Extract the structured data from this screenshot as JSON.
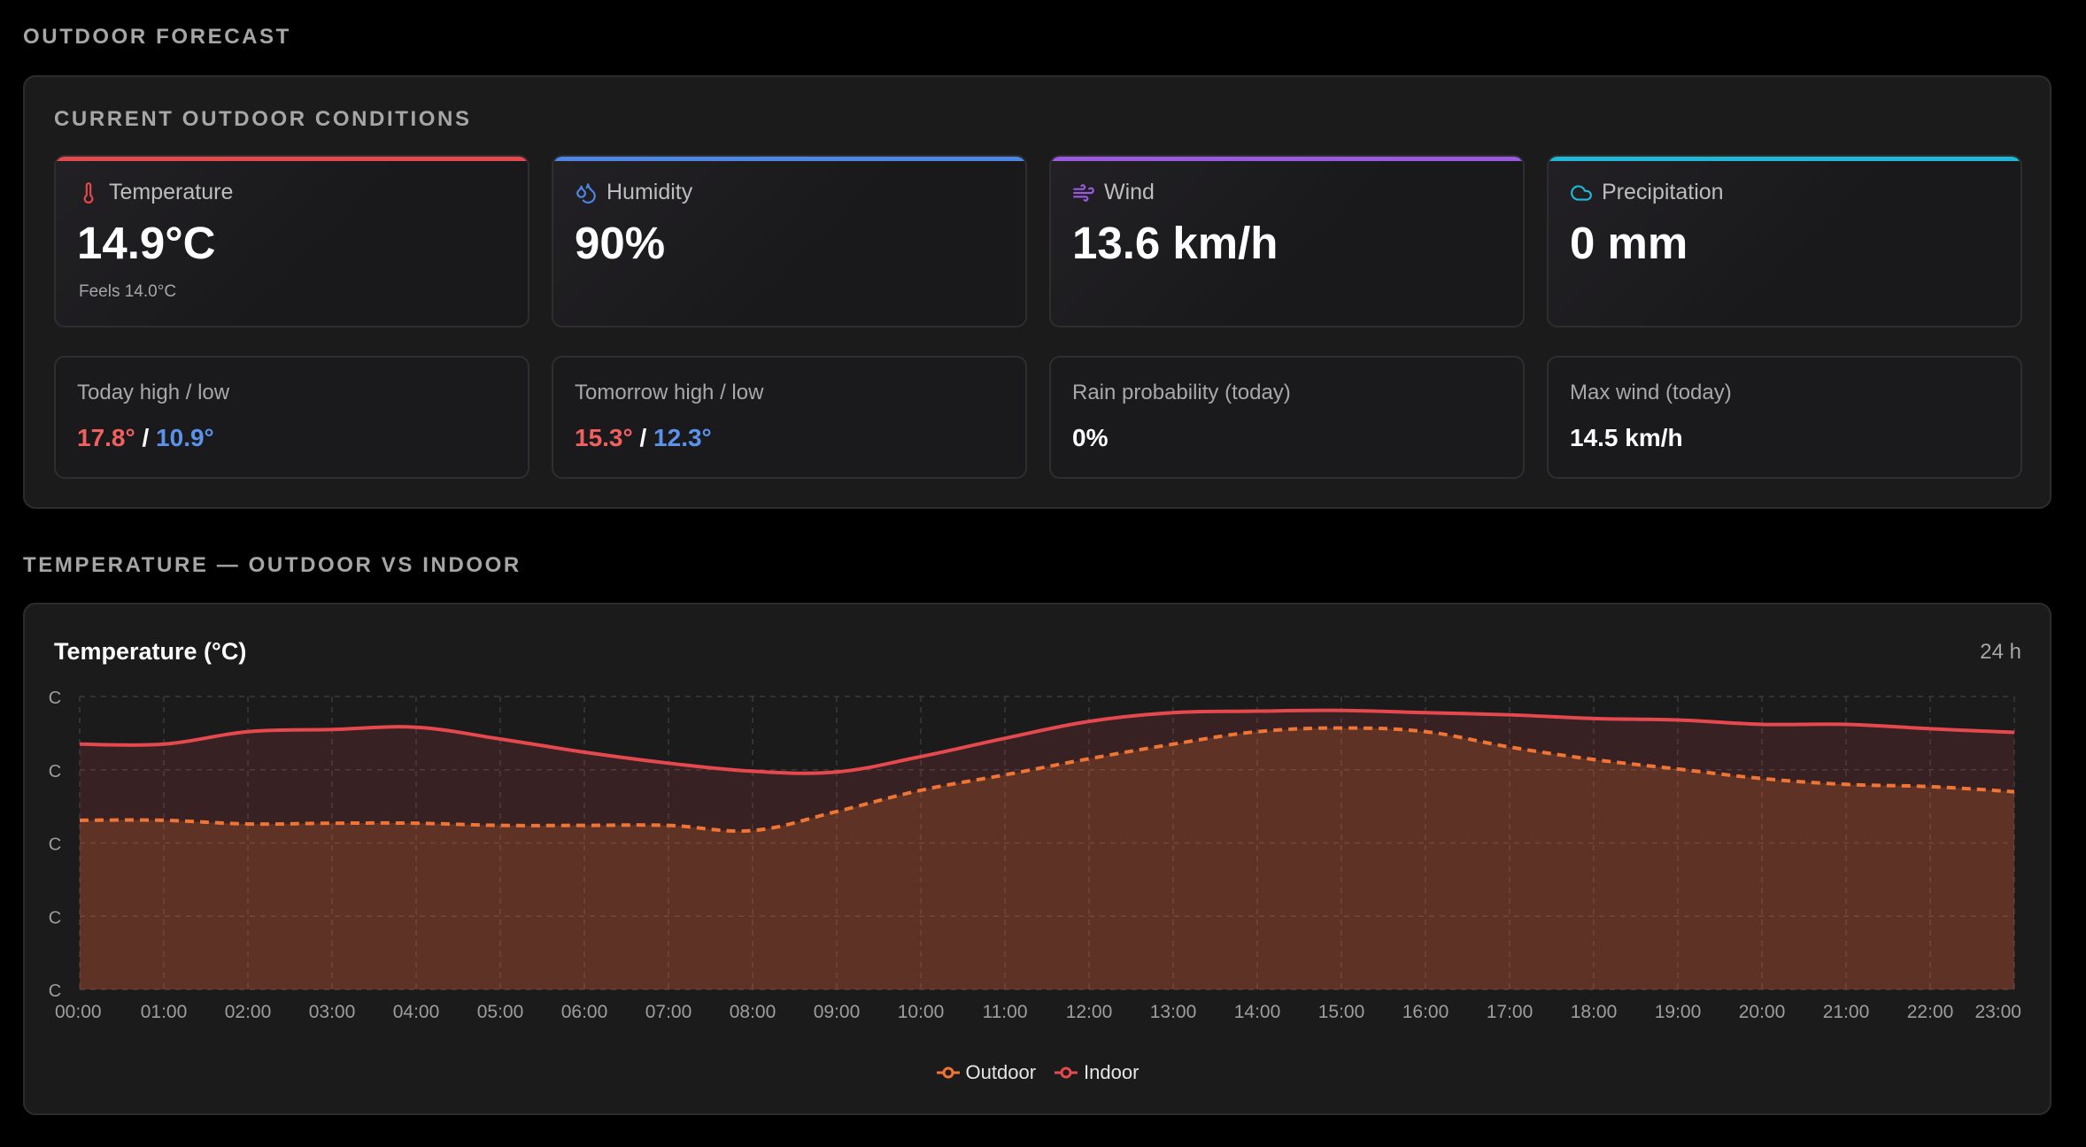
{
  "sections": {
    "forecast_title": "OUTDOOR FORECAST",
    "chart_section_title": "TEMPERATURE — OUTDOOR VS INDOOR"
  },
  "conditions": {
    "title": "CURRENT OUTDOOR CONDITIONS",
    "cards": [
      {
        "label": "Temperature",
        "value": "14.9°C",
        "sub": "Feels 14.0°C",
        "icon": "thermometer-icon",
        "accent": "#e5484d"
      },
      {
        "label": "Humidity",
        "value": "90%",
        "icon": "droplets-icon",
        "accent": "#4e86e6"
      },
      {
        "label": "Wind",
        "value": "13.6 km/h",
        "icon": "wind-icon",
        "accent": "#9b59e0"
      },
      {
        "label": "Precipitation",
        "value": "0 mm",
        "icon": "cloud-icon",
        "accent": "#1fb8d6"
      }
    ],
    "stats": [
      {
        "label": "Today high / low",
        "high": "17.8°",
        "low": "10.9°",
        "sep": " / "
      },
      {
        "label": "Tomorrow high / low",
        "high": "15.3°",
        "low": "12.3°",
        "sep": " / "
      },
      {
        "label": "Rain probability (today)",
        "value": "0%"
      },
      {
        "label": "Max wind (today)",
        "value": "14.5 km/h"
      }
    ]
  },
  "chart_data": {
    "type": "area",
    "title": "Temperature (°C)",
    "range_label": "24 h",
    "x": [
      "00:00",
      "01:00",
      "02:00",
      "03:00",
      "04:00",
      "05:00",
      "06:00",
      "07:00",
      "08:00",
      "09:00",
      "10:00",
      "11:00",
      "12:00",
      "13:00",
      "14:00",
      "15:00",
      "16:00",
      "17:00",
      "18:00",
      "19:00",
      "20:00",
      "21:00",
      "22:00",
      "23:00"
    ],
    "ylim": [
      0,
      4
    ],
    "y_tick_labels": [
      "C",
      "C",
      "C",
      "C",
      "C"
    ],
    "grid": true,
    "legend": "bottom",
    "series": [
      {
        "name": "Outdoor",
        "color": "#f07434",
        "dashed": true,
        "values": [
          2.31,
          2.31,
          2.26,
          2.27,
          2.27,
          2.24,
          2.24,
          2.24,
          2.17,
          2.43,
          2.72,
          2.93,
          3.15,
          3.35,
          3.52,
          3.57,
          3.52,
          3.31,
          3.14,
          3.01,
          2.88,
          2.8,
          2.77,
          2.7
        ]
      },
      {
        "name": "Indoor",
        "color": "#e5484d",
        "dashed": false,
        "values": [
          3.35,
          3.35,
          3.52,
          3.55,
          3.58,
          3.42,
          3.24,
          3.09,
          2.98,
          2.97,
          3.18,
          3.43,
          3.66,
          3.78,
          3.8,
          3.81,
          3.78,
          3.75,
          3.7,
          3.68,
          3.62,
          3.62,
          3.56,
          3.51
        ]
      }
    ]
  }
}
